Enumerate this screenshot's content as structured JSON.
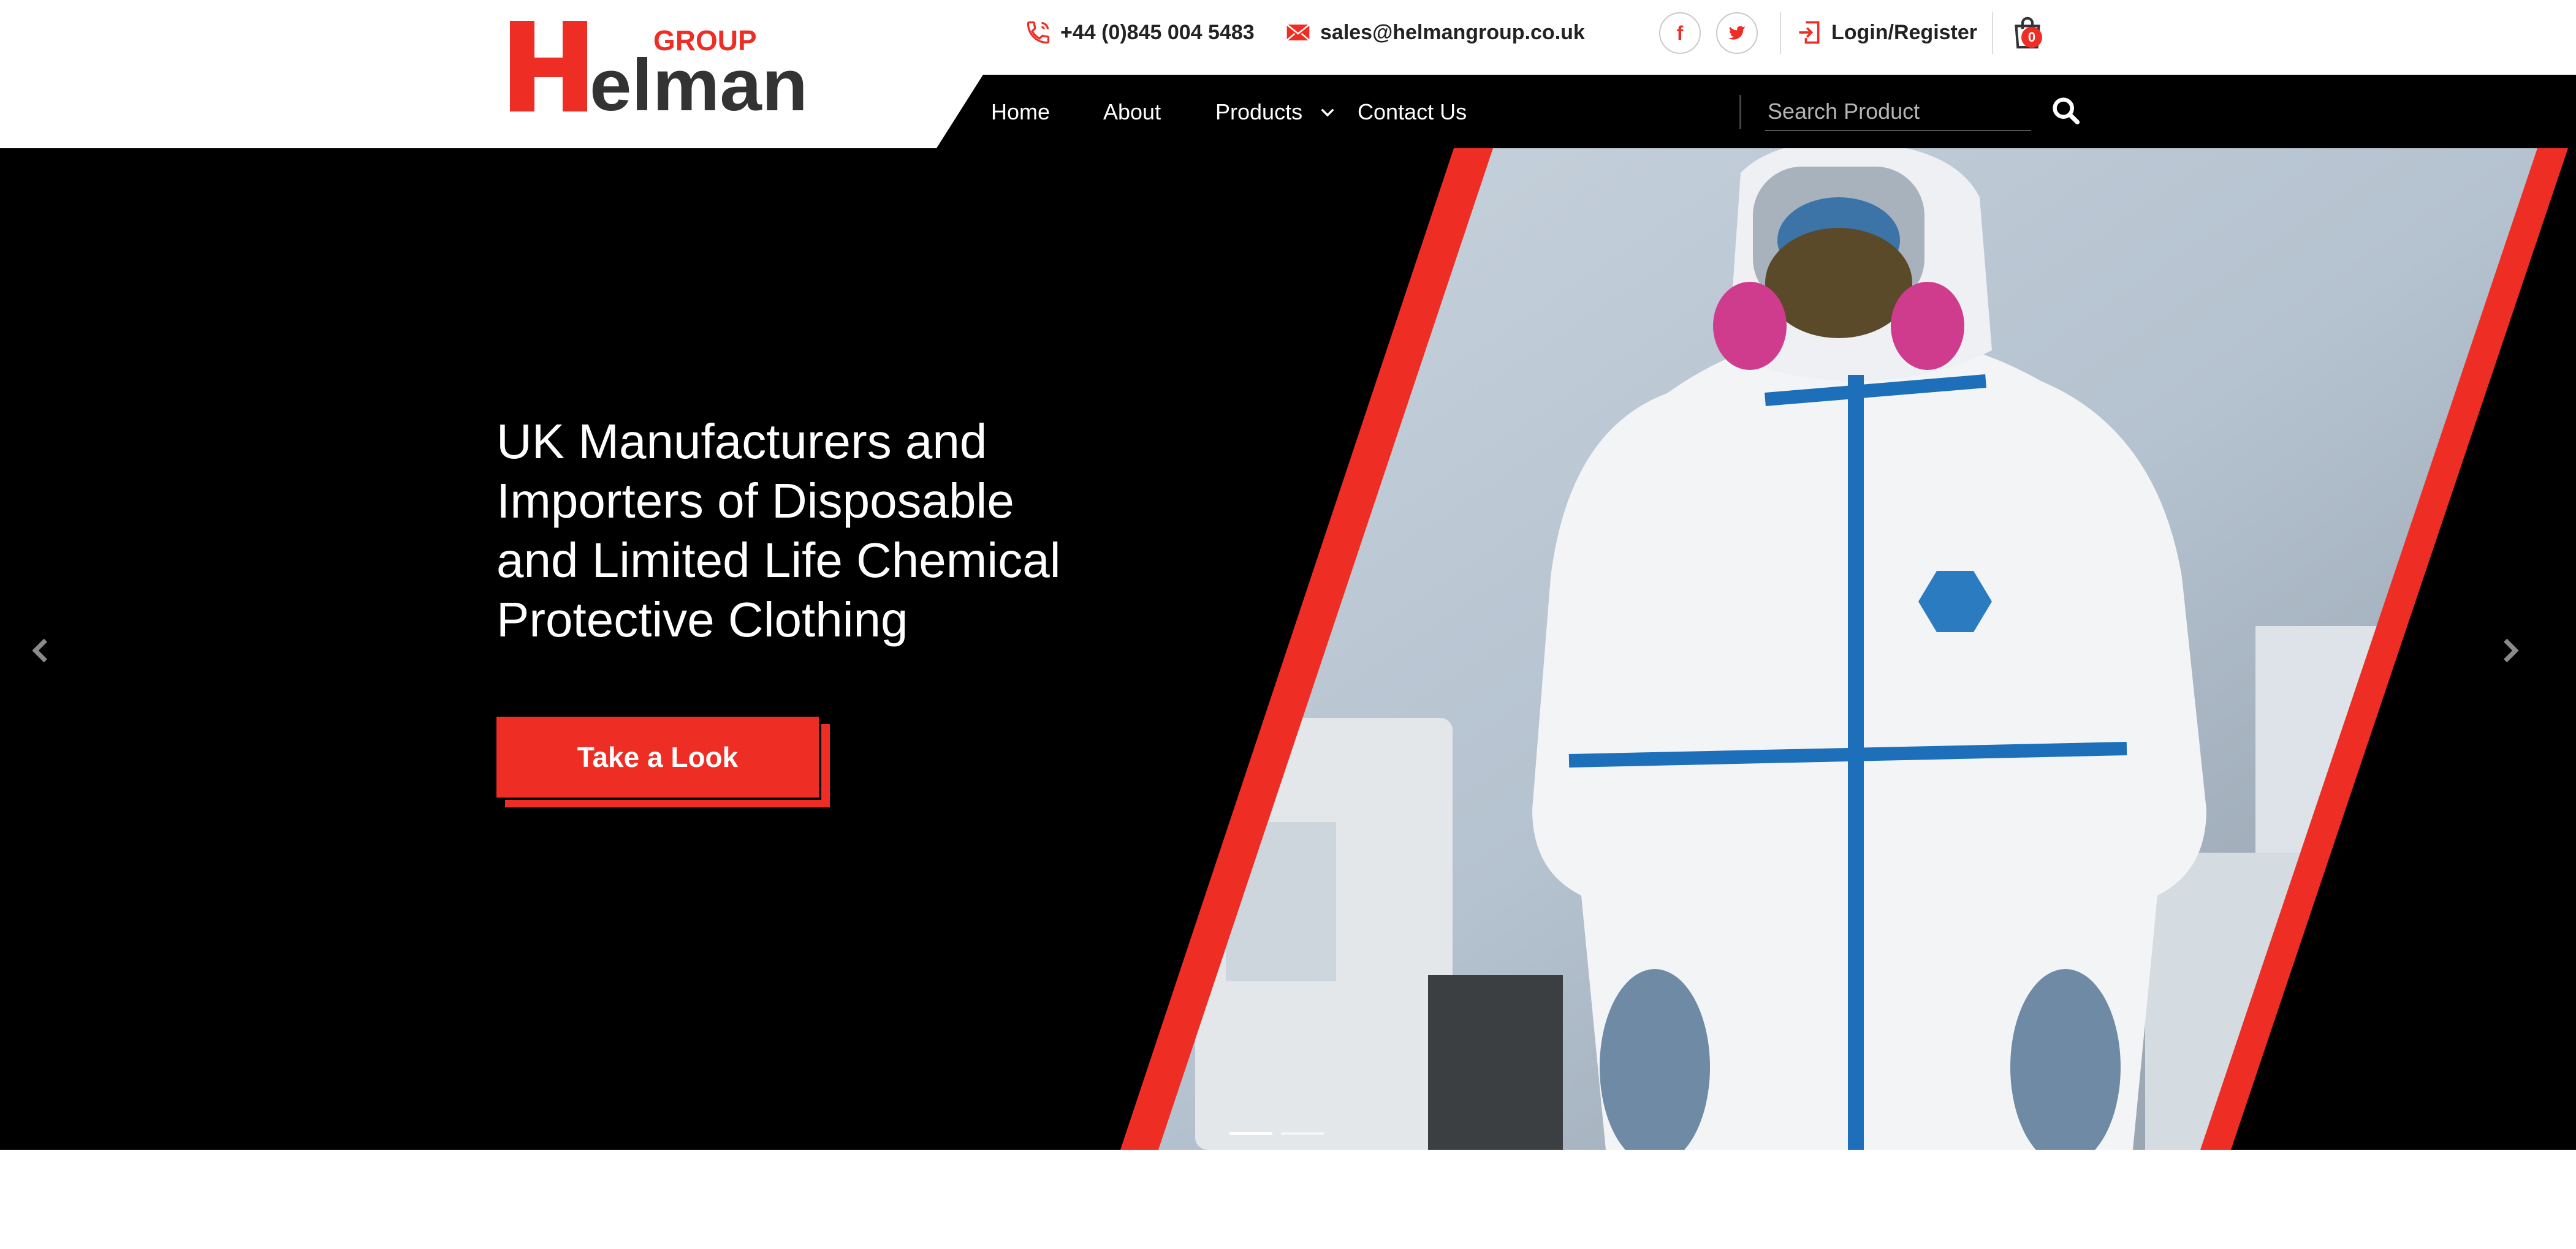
{
  "brand": {
    "logo_text": "Helman",
    "logo_tag": "GROUP",
    "accent": "#ee2e24",
    "dark": "#000000"
  },
  "topbar": {
    "phone": "+44 (0)845 004 5483",
    "email": "sales@helmangroup.co.uk",
    "social": [
      "facebook-icon",
      "twitter-icon"
    ],
    "login_label": "Login/Register",
    "cart_count": "0"
  },
  "nav": {
    "items": [
      {
        "label": "Home"
      },
      {
        "label": "About"
      },
      {
        "label": "Products",
        "has_dropdown": true
      },
      {
        "label": "Contact Us"
      }
    ],
    "search_placeholder": "Search Product"
  },
  "hero": {
    "title": "UK Manufacturers and Importers of Disposable and Limited Life Chemical Protective Clothing",
    "cta_label": "Take a Look",
    "slide_count": 2,
    "active_slide": 1
  }
}
